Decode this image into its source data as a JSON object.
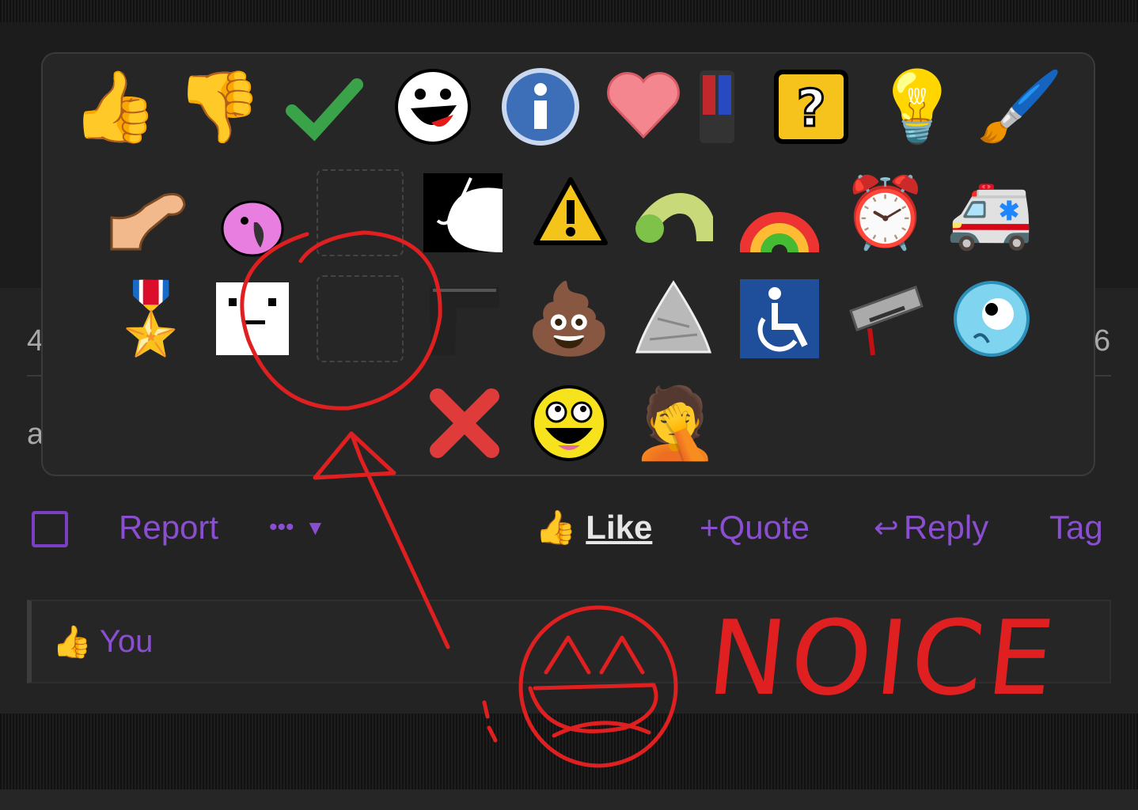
{
  "page": {
    "edge_left_4": "4",
    "edge_left_a": "a",
    "edge_right_6": "6"
  },
  "reaction_picker": {
    "rows": [
      [
        "thumbs-up",
        "thumbs-down",
        "check-mark",
        "laughing-face",
        "info",
        "heart",
        "police-light",
        "question-block",
        "light-bulb",
        "paintbrush"
      ],
      [
        "phallus",
        "parrot",
        "yellow-star-badge (not reproduced)",
        "fishing-hook-fish",
        "warning",
        "green-worm",
        "rainbow",
        "alarm-clock",
        "ambulance"
      ],
      [
        "medal",
        "deadpan-face",
        "face-photo (not reproduced)",
        "pistol",
        "poop",
        "tinfoil-hat",
        "wheelchair",
        "razor-blade",
        "googly-eye-face"
      ],
      [
        "red-x",
        "awesome-face",
        "facepalm"
      ]
    ]
  },
  "actions": {
    "report": "Report",
    "more": "•••",
    "like": "Like",
    "quote": "Quote",
    "reply": "Reply",
    "tag": "Tag"
  },
  "reactions_list": {
    "you": "You"
  },
  "annotation": {
    "text": "NOICE"
  },
  "colors": {
    "accent": "#8a4fd0",
    "annotation": "#e02020",
    "panel": "#262626"
  }
}
